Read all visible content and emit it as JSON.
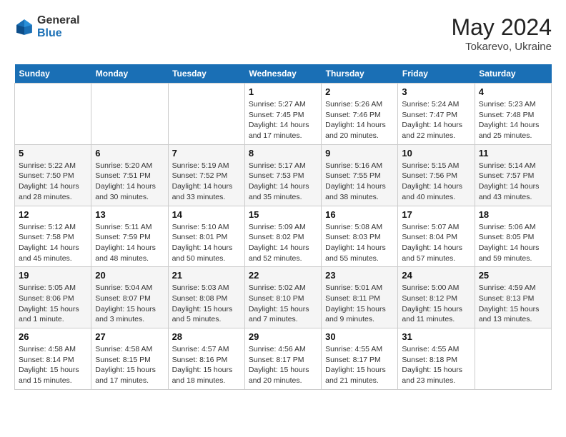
{
  "header": {
    "logo_general": "General",
    "logo_blue": "Blue",
    "month_year": "May 2024",
    "location": "Tokarevo, Ukraine"
  },
  "weekdays": [
    "Sunday",
    "Monday",
    "Tuesday",
    "Wednesday",
    "Thursday",
    "Friday",
    "Saturday"
  ],
  "weeks": [
    [
      {
        "day": "",
        "info": ""
      },
      {
        "day": "",
        "info": ""
      },
      {
        "day": "",
        "info": ""
      },
      {
        "day": "1",
        "info": "Sunrise: 5:27 AM\nSunset: 7:45 PM\nDaylight: 14 hours\nand 17 minutes."
      },
      {
        "day": "2",
        "info": "Sunrise: 5:26 AM\nSunset: 7:46 PM\nDaylight: 14 hours\nand 20 minutes."
      },
      {
        "day": "3",
        "info": "Sunrise: 5:24 AM\nSunset: 7:47 PM\nDaylight: 14 hours\nand 22 minutes."
      },
      {
        "day": "4",
        "info": "Sunrise: 5:23 AM\nSunset: 7:48 PM\nDaylight: 14 hours\nand 25 minutes."
      }
    ],
    [
      {
        "day": "5",
        "info": "Sunrise: 5:22 AM\nSunset: 7:50 PM\nDaylight: 14 hours\nand 28 minutes."
      },
      {
        "day": "6",
        "info": "Sunrise: 5:20 AM\nSunset: 7:51 PM\nDaylight: 14 hours\nand 30 minutes."
      },
      {
        "day": "7",
        "info": "Sunrise: 5:19 AM\nSunset: 7:52 PM\nDaylight: 14 hours\nand 33 minutes."
      },
      {
        "day": "8",
        "info": "Sunrise: 5:17 AM\nSunset: 7:53 PM\nDaylight: 14 hours\nand 35 minutes."
      },
      {
        "day": "9",
        "info": "Sunrise: 5:16 AM\nSunset: 7:55 PM\nDaylight: 14 hours\nand 38 minutes."
      },
      {
        "day": "10",
        "info": "Sunrise: 5:15 AM\nSunset: 7:56 PM\nDaylight: 14 hours\nand 40 minutes."
      },
      {
        "day": "11",
        "info": "Sunrise: 5:14 AM\nSunset: 7:57 PM\nDaylight: 14 hours\nand 43 minutes."
      }
    ],
    [
      {
        "day": "12",
        "info": "Sunrise: 5:12 AM\nSunset: 7:58 PM\nDaylight: 14 hours\nand 45 minutes."
      },
      {
        "day": "13",
        "info": "Sunrise: 5:11 AM\nSunset: 7:59 PM\nDaylight: 14 hours\nand 48 minutes."
      },
      {
        "day": "14",
        "info": "Sunrise: 5:10 AM\nSunset: 8:01 PM\nDaylight: 14 hours\nand 50 minutes."
      },
      {
        "day": "15",
        "info": "Sunrise: 5:09 AM\nSunset: 8:02 PM\nDaylight: 14 hours\nand 52 minutes."
      },
      {
        "day": "16",
        "info": "Sunrise: 5:08 AM\nSunset: 8:03 PM\nDaylight: 14 hours\nand 55 minutes."
      },
      {
        "day": "17",
        "info": "Sunrise: 5:07 AM\nSunset: 8:04 PM\nDaylight: 14 hours\nand 57 minutes."
      },
      {
        "day": "18",
        "info": "Sunrise: 5:06 AM\nSunset: 8:05 PM\nDaylight: 14 hours\nand 59 minutes."
      }
    ],
    [
      {
        "day": "19",
        "info": "Sunrise: 5:05 AM\nSunset: 8:06 PM\nDaylight: 15 hours\nand 1 minute."
      },
      {
        "day": "20",
        "info": "Sunrise: 5:04 AM\nSunset: 8:07 PM\nDaylight: 15 hours\nand 3 minutes."
      },
      {
        "day": "21",
        "info": "Sunrise: 5:03 AM\nSunset: 8:08 PM\nDaylight: 15 hours\nand 5 minutes."
      },
      {
        "day": "22",
        "info": "Sunrise: 5:02 AM\nSunset: 8:10 PM\nDaylight: 15 hours\nand 7 minutes."
      },
      {
        "day": "23",
        "info": "Sunrise: 5:01 AM\nSunset: 8:11 PM\nDaylight: 15 hours\nand 9 minutes."
      },
      {
        "day": "24",
        "info": "Sunrise: 5:00 AM\nSunset: 8:12 PM\nDaylight: 15 hours\nand 11 minutes."
      },
      {
        "day": "25",
        "info": "Sunrise: 4:59 AM\nSunset: 8:13 PM\nDaylight: 15 hours\nand 13 minutes."
      }
    ],
    [
      {
        "day": "26",
        "info": "Sunrise: 4:58 AM\nSunset: 8:14 PM\nDaylight: 15 hours\nand 15 minutes."
      },
      {
        "day": "27",
        "info": "Sunrise: 4:58 AM\nSunset: 8:15 PM\nDaylight: 15 hours\nand 17 minutes."
      },
      {
        "day": "28",
        "info": "Sunrise: 4:57 AM\nSunset: 8:16 PM\nDaylight: 15 hours\nand 18 minutes."
      },
      {
        "day": "29",
        "info": "Sunrise: 4:56 AM\nSunset: 8:17 PM\nDaylight: 15 hours\nand 20 minutes."
      },
      {
        "day": "30",
        "info": "Sunrise: 4:55 AM\nSunset: 8:17 PM\nDaylight: 15 hours\nand 21 minutes."
      },
      {
        "day": "31",
        "info": "Sunrise: 4:55 AM\nSunset: 8:18 PM\nDaylight: 15 hours\nand 23 minutes."
      },
      {
        "day": "",
        "info": ""
      }
    ]
  ]
}
